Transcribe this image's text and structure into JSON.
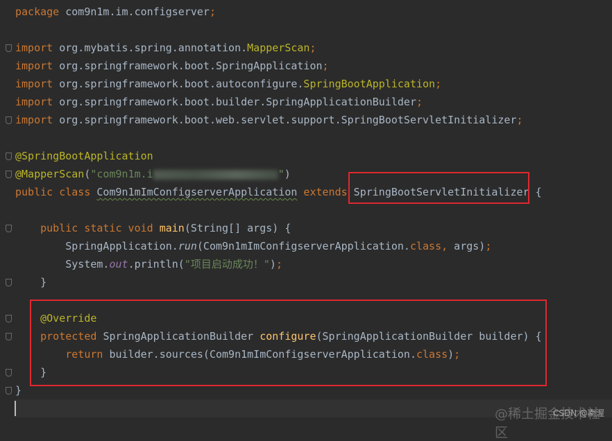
{
  "editor": {
    "lines": [
      [
        [
          "k",
          "package "
        ],
        [
          "t",
          "com9n1m.im.configserver"
        ],
        [
          "k",
          ";"
        ]
      ],
      [],
      [
        [
          "k",
          "import "
        ],
        [
          "t",
          "org.mybatis.spring.annotation."
        ],
        [
          "a",
          "MapperScan"
        ],
        [
          "k",
          ";"
        ]
      ],
      [
        [
          "k",
          "import "
        ],
        [
          "t",
          "org.springframework.boot.SpringApplication"
        ],
        [
          "k",
          ";"
        ]
      ],
      [
        [
          "k",
          "import "
        ],
        [
          "t",
          "org.springframework.boot.autoconfigure."
        ],
        [
          "a",
          "SpringBootApplication"
        ],
        [
          "k",
          ";"
        ]
      ],
      [
        [
          "k",
          "import "
        ],
        [
          "t",
          "org.springframework.boot.builder.SpringApplicationBuilder"
        ],
        [
          "k",
          ";"
        ]
      ],
      [
        [
          "k",
          "import "
        ],
        [
          "t",
          "org.springframework.boot.web.servlet.support.SpringBootServletInitializer"
        ],
        [
          "k",
          ";"
        ]
      ],
      [],
      [
        [
          "a",
          "@SpringBootApplication"
        ]
      ],
      [
        [
          "a",
          "@MapperScan"
        ],
        [
          "t",
          "("
        ],
        [
          "s",
          "\"com9n1m.i"
        ],
        [
          "blur",
          ""
        ],
        [
          "s",
          "\""
        ],
        [
          "t",
          ")"
        ]
      ],
      [
        [
          "k",
          "public class "
        ],
        [
          "tu",
          "Com9n1mImConfigserverApplication"
        ],
        [
          "k",
          " extends "
        ],
        [
          "t",
          "SpringBootServletInitializer {"
        ]
      ],
      [],
      [
        [
          "t",
          "    "
        ],
        [
          "k",
          "public static void "
        ],
        [
          "y",
          "main"
        ],
        [
          "t",
          "(String[] args) {"
        ]
      ],
      [
        [
          "t",
          "        SpringApplication."
        ],
        [
          "m",
          "run"
        ],
        [
          "t",
          "(Com9n1mImConfigserverApplication."
        ],
        [
          "k",
          "class"
        ],
        [
          "k",
          ", "
        ],
        [
          "t",
          "args)"
        ],
        [
          "k",
          ";"
        ]
      ],
      [
        [
          "t",
          "        System."
        ],
        [
          "i",
          "out"
        ],
        [
          "t",
          ".println("
        ],
        [
          "s",
          "\"项目启动成功！\""
        ],
        [
          "t",
          ")"
        ],
        [
          "k",
          ";"
        ]
      ],
      [
        [
          "t",
          "    }"
        ]
      ],
      [],
      [
        [
          "t",
          "    "
        ],
        [
          "a",
          "@Override"
        ]
      ],
      [
        [
          "t",
          "    "
        ],
        [
          "k",
          "protected "
        ],
        [
          "t",
          "SpringApplicationBuilder "
        ],
        [
          "y",
          "configure"
        ],
        [
          "t",
          "(SpringApplicationBuilder builder) {"
        ]
      ],
      [
        [
          "t",
          "        "
        ],
        [
          "k",
          "return "
        ],
        [
          "t",
          "builder.sources(Com9n1mImConfigserverApplication."
        ],
        [
          "k",
          "class"
        ],
        [
          "t",
          ")"
        ],
        [
          "k",
          ";"
        ]
      ],
      [
        [
          "t",
          "    }"
        ]
      ],
      [
        [
          "t",
          "}"
        ]
      ],
      []
    ],
    "fold_markers_on_lines": [
      2,
      6,
      8,
      9,
      12,
      15,
      17,
      18,
      20,
      21
    ],
    "highlight_color": "#e0282e"
  },
  "watermark": {
    "juejin": "@稀土掘金技术社区",
    "csdn": "CSDN @南渥"
  }
}
